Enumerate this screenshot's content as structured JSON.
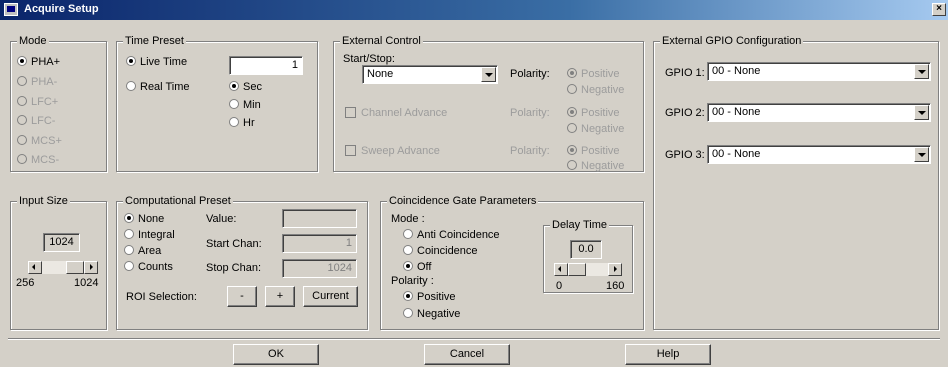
{
  "window": {
    "title": "Acquire Setup",
    "close_label": "×"
  },
  "mode": {
    "title": "Mode",
    "options": [
      "PHA+",
      "PHA-",
      "LFC+",
      "LFC-",
      "MCS+",
      "MCS-"
    ]
  },
  "time_preset": {
    "title": "Time Preset",
    "live_label": "Live Time",
    "real_label": "Real Time",
    "value": "1",
    "units": [
      "Sec",
      "Min",
      "Hr"
    ]
  },
  "external_control": {
    "title": "External Control",
    "start_stop_label": "Start/Stop:",
    "start_stop_value": "None",
    "polarity_label": "Polarity:",
    "positive": "Positive",
    "negative": "Negative",
    "channel_advance": "Channel Advance",
    "sweep_advance": "Sweep Advance"
  },
  "gpio": {
    "title": "External GPIO Configuration",
    "items": [
      {
        "label": "GPIO 1:",
        "value": "00 - None"
      },
      {
        "label": "GPIO 2:",
        "value": "00 - None"
      },
      {
        "label": "GPIO 3:",
        "value": "00 - None"
      }
    ]
  },
  "input_size": {
    "title": "Input Size",
    "value": "1024",
    "min": "256",
    "max": "1024",
    "level": 1.0
  },
  "computational_preset": {
    "title": "Computational Preset",
    "options": [
      "None",
      "Integral",
      "Area",
      "Counts"
    ],
    "value_label": "Value:",
    "value": "",
    "start_label": "Start Chan:",
    "start_value": "1",
    "stop_label": "Stop Chan:",
    "stop_value": "1024",
    "roi_label": "ROI Selection:",
    "minus": "-",
    "plus": "+",
    "current": "Current"
  },
  "coincidence": {
    "title": "Coincidence Gate Parameters",
    "mode_label": "Mode :",
    "modes": [
      "Anti Coincidence",
      "Coincidence",
      "Off"
    ],
    "polarity_label": "Polarity :",
    "positive": "Positive",
    "negative": "Negative",
    "delay_title": "Delay Time",
    "delay_value": "0.0",
    "delay_min": "0",
    "delay_max": "160",
    "delay_level": 0.0
  },
  "footer": {
    "ok": "OK",
    "cancel": "Cancel",
    "help": "Help"
  }
}
